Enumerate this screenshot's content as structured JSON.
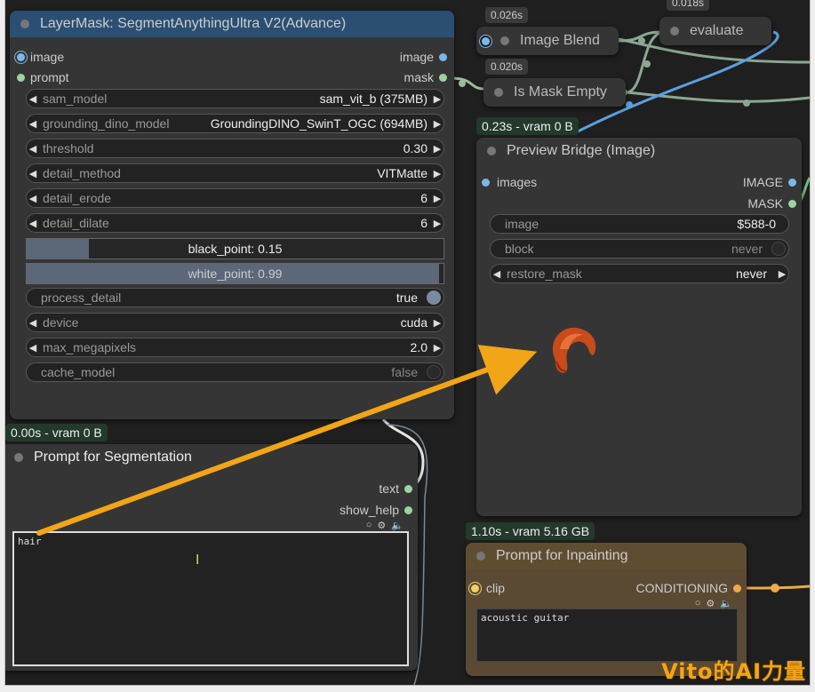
{
  "layermask_node": {
    "title": "LayerMask: SegmentAnythingUltra V2(Advance)",
    "inputs": [
      "image",
      "prompt"
    ],
    "outputs": [
      "image",
      "mask"
    ],
    "widgets": [
      {
        "label": "sam_model",
        "value": "sam_vit_b (375MB)"
      },
      {
        "label": "grounding_dino_model",
        "value": "GroundingDINO_SwinT_OGC (694MB)"
      },
      {
        "label": "threshold",
        "value": "0.30"
      },
      {
        "label": "detail_method",
        "value": "VITMatte"
      },
      {
        "label": "detail_erode",
        "value": "6"
      },
      {
        "label": "detail_dilate",
        "value": "6"
      }
    ],
    "black_point": {
      "text": "black_point: 0.15",
      "fraction": 0.15
    },
    "white_point": {
      "text": "white_point: 0.99",
      "fraction": 0.99
    },
    "process_detail": {
      "label": "process_detail",
      "value": "true"
    },
    "device": {
      "label": "device",
      "value": "cuda"
    },
    "max_megapixels": {
      "label": "max_megapixels",
      "value": "2.0"
    },
    "cache_model": {
      "label": "cache_model",
      "value": "false"
    }
  },
  "image_blend": {
    "time": "0.026s",
    "title": "Image Blend"
  },
  "evaluate": {
    "time": "0.018s",
    "title": "evaluate"
  },
  "is_mask_empty": {
    "time": "0.020s",
    "title": "Is Mask Empty"
  },
  "preview_bridge": {
    "badge": "0.23s - vram 0 B",
    "title": "Preview Bridge (Image)",
    "input": "images",
    "outputs": [
      "IMAGE",
      "MASK"
    ],
    "widgets": [
      {
        "label": "image",
        "value": "$588-0"
      },
      {
        "label": "block",
        "value": "never"
      },
      {
        "label": "restore_mask",
        "value": "never"
      }
    ]
  },
  "prompt_seg": {
    "badge": "0.00s - vram 0 B",
    "title": "Prompt for Segmentation",
    "outputs": [
      "text",
      "show_help"
    ],
    "text": "hair"
  },
  "prompt_inpaint": {
    "badge": "1.10s - vram 5.16 GB",
    "title": "Prompt for Inpainting",
    "input": "clip",
    "output": "CONDITIONING",
    "text": "acoustic guitar"
  },
  "watermark": "Vito的AI力量",
  "colors": {
    "arrow": "#f2a516",
    "accent_blue": "#3b6ea5",
    "inpaint_node": "#5a4a34"
  }
}
